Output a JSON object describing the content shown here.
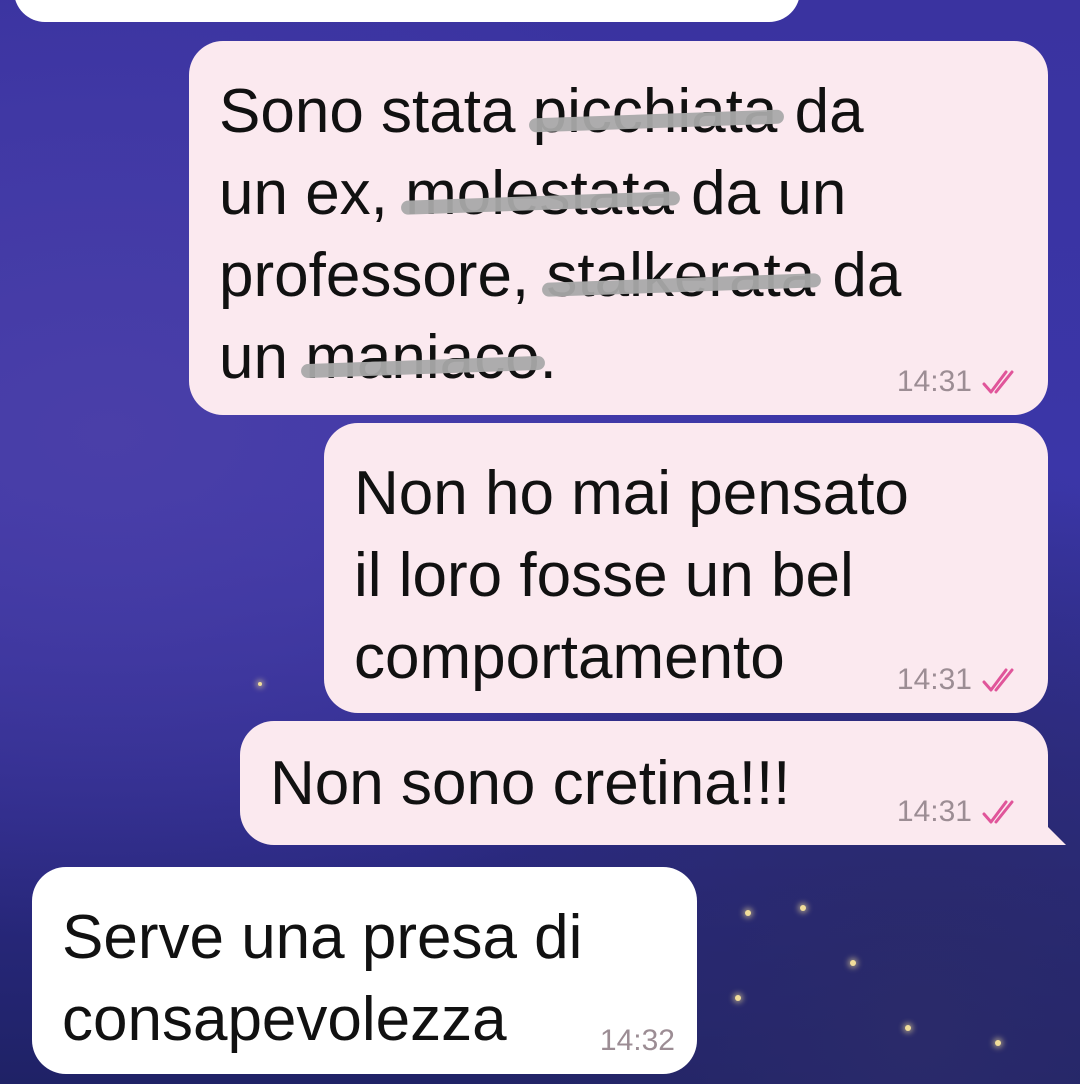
{
  "messages": [
    {
      "id": "m1",
      "direction": "outgoing",
      "text_parts": [
        "Sono stata ",
        "picchiata",
        " da\nun ex, ",
        "molestata",
        " da un\nprofessore, ",
        "stalkerata",
        " da\nun ",
        "maniaco",
        "."
      ],
      "time": "14:31",
      "status": "read"
    },
    {
      "id": "m2",
      "direction": "outgoing",
      "text": "Non ho mai pensato\nil loro fosse un bel\ncomportamento",
      "time": "14:31",
      "status": "read"
    },
    {
      "id": "m3",
      "direction": "outgoing",
      "text": "Non sono cretina!!!",
      "time": "14:31",
      "status": "read"
    },
    {
      "id": "m4",
      "direction": "incoming",
      "text": "Serve una presa di\nconsapevolezza",
      "time": "14:32"
    }
  ],
  "colors": {
    "outgoing_bubble": "#fbe9ef",
    "incoming_bubble": "#ffffff",
    "read_ticks": "#e0559a",
    "timestamp": "#9c8d94"
  },
  "icons": {
    "read_status": "double-check-icon"
  }
}
